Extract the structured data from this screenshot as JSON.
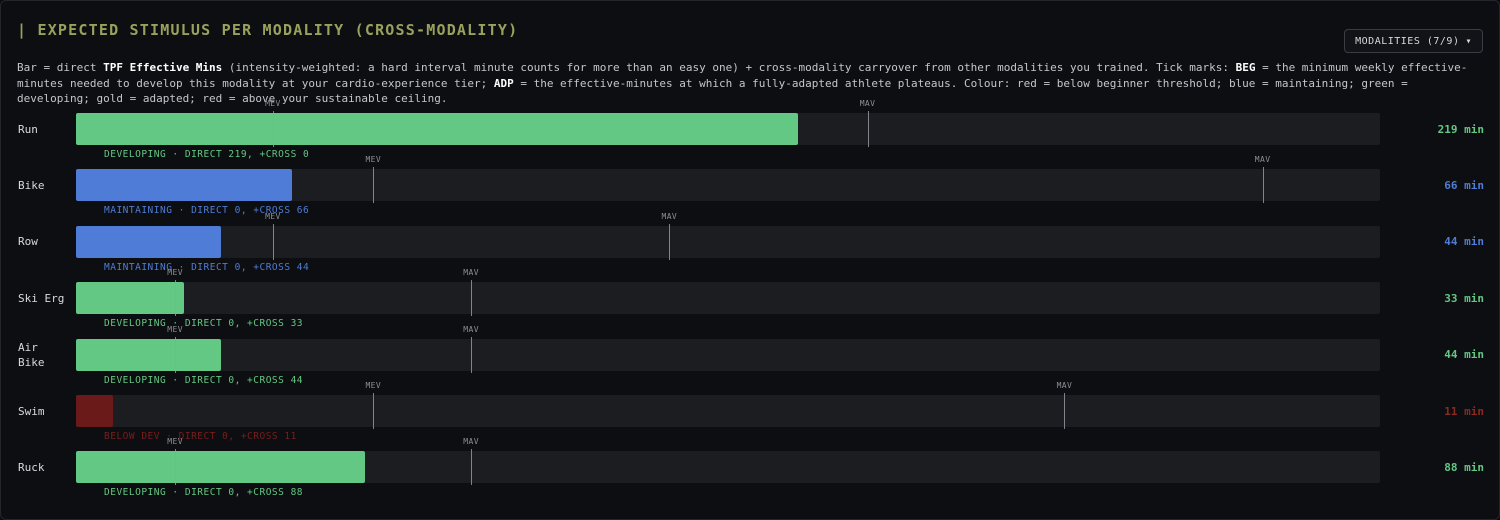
{
  "header": {
    "title": "| Expected Stimulus Per Modality (Cross-Modality)",
    "modalities_button": "MODALITIES (7/9)",
    "dropdown_icon": "▾"
  },
  "description": {
    "p1": "Bar = direct ",
    "b1": "TPF Effective Mins",
    "p2": " (intensity-weighted: a hard interval minute counts for more than an easy one) + cross-modality carryover from other modalities you trained. Tick marks: ",
    "b2": "BEG",
    "p3": " = the minimum weekly effective-minutes needed to develop this modality at your cardio-experience tier; ",
    "b3": "ADP",
    "p4": " = the effective-minutes at which a fully-adapted athlete plateaus. Colour: red = below beginner threshold; blue = maintaining; green = developing; gold = adapted; red = above your sustainable ceiling."
  },
  "colors": {
    "developing": "#63c883",
    "maintaining": "#4f7cd6",
    "below": "#6b1a1a"
  },
  "tick_labels": {
    "mev": "MEV",
    "mav": "MAV"
  },
  "rows": [
    {
      "name": "Run",
      "value": "219 min",
      "status": "DEVELOPING · DIRECT 219, +CROSS 0",
      "state": "developing",
      "fill": 0.554,
      "mev": 0.151,
      "mav": 0.607
    },
    {
      "name": "Bike",
      "value": "66 min",
      "status": "MAINTAINING · DIRECT 0, +CROSS 66",
      "state": "maintaining",
      "fill": 0.166,
      "mev": 0.228,
      "mav": 0.91
    },
    {
      "name": "Row",
      "value": "44 min",
      "status": "MAINTAINING · DIRECT 0, +CROSS 44",
      "state": "maintaining",
      "fill": 0.111,
      "mev": 0.151,
      "mav": 0.455
    },
    {
      "name": "Ski Erg",
      "value": "33 min",
      "status": "DEVELOPING · DIRECT 0, +CROSS 33",
      "state": "developing",
      "fill": 0.083,
      "mev": 0.076,
      "mav": 0.303
    },
    {
      "name": "Air Bike",
      "value": "44 min",
      "status": "DEVELOPING · DIRECT 0, +CROSS 44",
      "state": "developing",
      "fill": 0.111,
      "mev": 0.076,
      "mav": 0.303
    },
    {
      "name": "Swim",
      "value": "11 min",
      "status": "BELOW DEV · DIRECT 0, +CROSS 11",
      "state": "below",
      "fill": 0.028,
      "mev": 0.228,
      "mav": 0.758
    },
    {
      "name": "Ruck",
      "value": "88 min",
      "status": "DEVELOPING · DIRECT 0, +CROSS 88",
      "state": "developing",
      "fill": 0.222,
      "mev": 0.076,
      "mav": 0.303
    }
  ]
}
